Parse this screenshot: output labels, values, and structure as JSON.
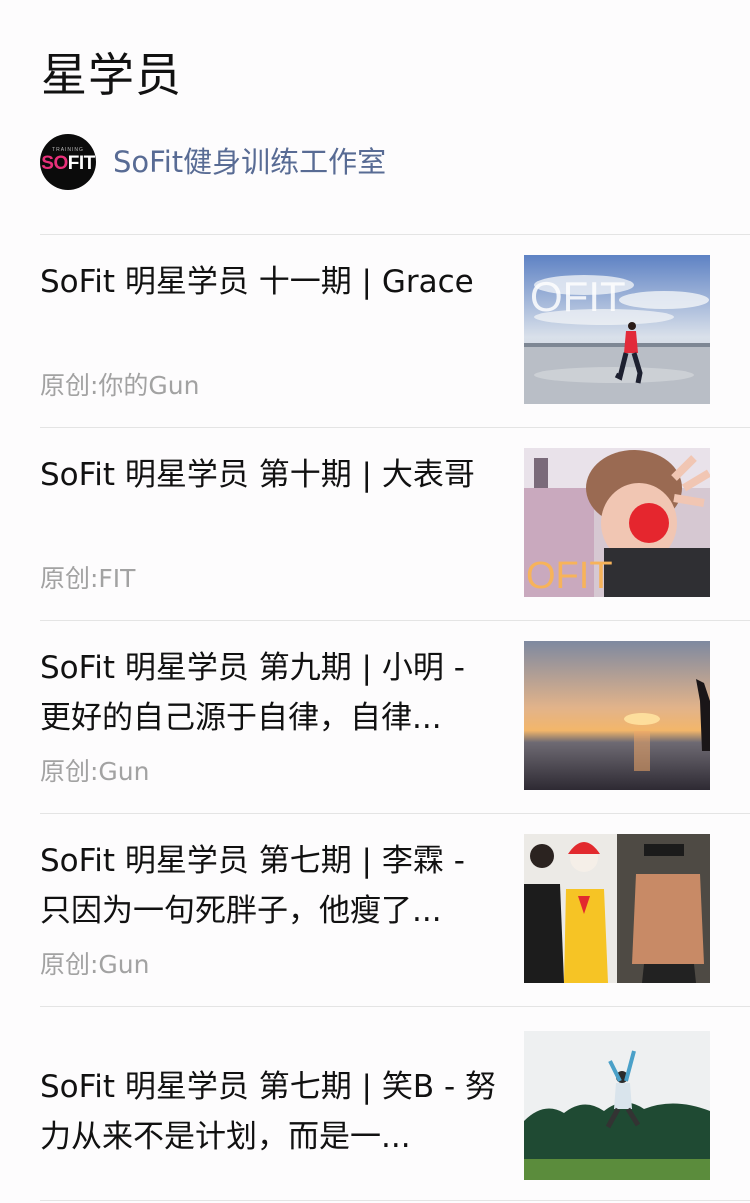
{
  "page": {
    "title": "星学员"
  },
  "account": {
    "name": "SoFit健身训练工作室",
    "avatar_logo_small": "TRAINING",
    "avatar_logo_pink": "SO",
    "avatar_logo_white": "FIT",
    "avatar_icon": "sofit-logo"
  },
  "articles": [
    {
      "title": "SoFit 明星学员 十一期 | Grace",
      "source": "原创:你的Gun",
      "thumb_icon": "runner-on-salt-flat-image"
    },
    {
      "title": "SoFit 明星学员 第十期 | 大表哥",
      "source": "原创:FIT",
      "thumb_icon": "selfie-with-red-nose-image"
    },
    {
      "title": "SoFit 明星学员 第九期 | 小明 - 更好的自己源于自律，自律...",
      "source": "原创:Gun",
      "thumb_icon": "sunset-beach-image"
    },
    {
      "title": "SoFit 明星学员 第七期 | 李霖 - 只因为一句死胖子，他瘦了...",
      "source": "原创:Gun",
      "thumb_icon": "before-after-collage-image"
    },
    {
      "title": "SoFit 明星学员 第七期 | 笑B - 努力从来不是计划，而是一...",
      "source": "",
      "thumb_icon": "jumping-in-forest-image"
    }
  ],
  "colors": {
    "account_link": "#586b94",
    "source_gray": "#a2a2a2",
    "divider": "#e4e4e4",
    "logo_pink": "#e8307a"
  }
}
